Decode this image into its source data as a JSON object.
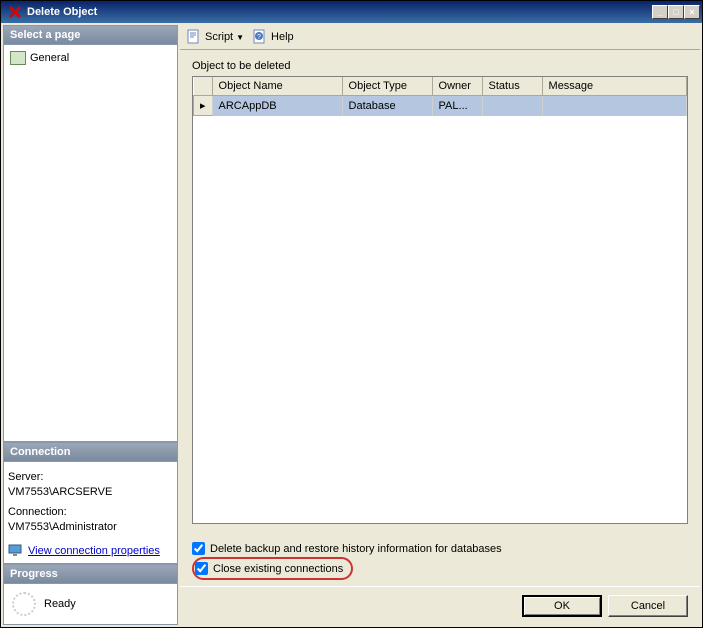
{
  "window": {
    "title": "Delete Object"
  },
  "sidebar": {
    "pages": {
      "header": "Select a page",
      "items": [
        {
          "label": "General"
        }
      ]
    },
    "connection": {
      "header": "Connection",
      "server_label": "Server:",
      "server_value": "VM7553\\ARCSERVE",
      "connection_label": "Connection:",
      "connection_value": "VM7553\\Administrator",
      "link_text": "View connection properties"
    },
    "progress": {
      "header": "Progress",
      "status": "Ready"
    }
  },
  "toolbar": {
    "script_label": "Script",
    "help_label": "Help"
  },
  "main": {
    "grid_label": "Object to be deleted",
    "columns": [
      "",
      "Object Name",
      "Object Type",
      "Owner",
      "Status",
      "Message"
    ],
    "rows": [
      {
        "name": "ARCAppDB",
        "type": "Database",
        "owner": "PAL...",
        "status": "",
        "message": ""
      }
    ],
    "checkboxes": {
      "delete_history": {
        "label": "Delete backup and restore history information for databases",
        "checked": true
      },
      "close_conn": {
        "label": "Close existing connections",
        "checked": true
      }
    }
  },
  "buttons": {
    "ok": "OK",
    "cancel": "Cancel"
  }
}
